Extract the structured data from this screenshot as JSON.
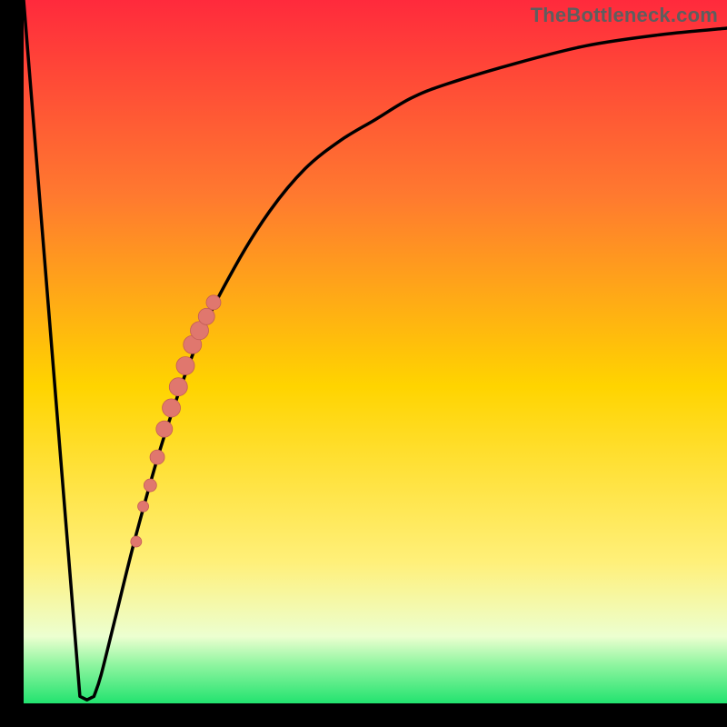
{
  "watermark": "TheBottleneck.com",
  "colors": {
    "bg_top": "#ff2a3c",
    "bg_mid_upper": "#ff7a2f",
    "bg_mid": "#ffd400",
    "bg_lower": "#fff07a",
    "bg_pale": "#ecffd0",
    "bg_green_light": "#8ff5a0",
    "bg_green": "#22e36f",
    "curve": "#000000",
    "axis": "#000000",
    "dot_fill": "#e0776e",
    "dot_edge": "#c35d56"
  },
  "chart_data": {
    "type": "line",
    "title": "",
    "xlabel": "",
    "ylabel": "",
    "xlim": [
      0,
      100
    ],
    "ylim": [
      0,
      100
    ],
    "series": [
      {
        "name": "bottleneck-curve",
        "description": "V-shaped curve: steep linear drop from top-left to a narrow floor near x≈9, then rises and asymptotically approaches y≈100 toward the right.",
        "x": [
          0,
          8,
          9,
          10,
          11,
          13,
          16,
          20,
          25,
          30,
          35,
          40,
          45,
          50,
          55,
          60,
          70,
          80,
          90,
          100
        ],
        "y": [
          100,
          1,
          0.5,
          1,
          4,
          12,
          24,
          38,
          52,
          62,
          70,
          76,
          80,
          83,
          86,
          88,
          91,
          93.5,
          95,
          96
        ]
      }
    ],
    "markers": [
      {
        "name": "highlighted-segment",
        "description": "Thick salmon marker cluster along the rising limb of the curve.",
        "points": [
          {
            "x": 16,
            "y": 23,
            "r": 6
          },
          {
            "x": 17,
            "y": 28,
            "r": 6
          },
          {
            "x": 18,
            "y": 31,
            "r": 7
          },
          {
            "x": 19,
            "y": 35,
            "r": 8
          },
          {
            "x": 20,
            "y": 39,
            "r": 9
          },
          {
            "x": 21,
            "y": 42,
            "r": 10
          },
          {
            "x": 22,
            "y": 45,
            "r": 10
          },
          {
            "x": 23,
            "y": 48,
            "r": 10
          },
          {
            "x": 24,
            "y": 51,
            "r": 10
          },
          {
            "x": 25,
            "y": 53,
            "r": 10
          },
          {
            "x": 26,
            "y": 55,
            "r": 9
          },
          {
            "x": 27,
            "y": 57,
            "r": 8
          }
        ]
      }
    ],
    "gradient_stops": [
      {
        "offset": 0.0,
        "key": "bg_top"
      },
      {
        "offset": 0.28,
        "key": "bg_mid_upper"
      },
      {
        "offset": 0.55,
        "key": "bg_mid"
      },
      {
        "offset": 0.8,
        "key": "bg_lower"
      },
      {
        "offset": 0.905,
        "key": "bg_pale"
      },
      {
        "offset": 0.945,
        "key": "bg_green_light"
      },
      {
        "offset": 1.0,
        "key": "bg_green"
      }
    ]
  }
}
